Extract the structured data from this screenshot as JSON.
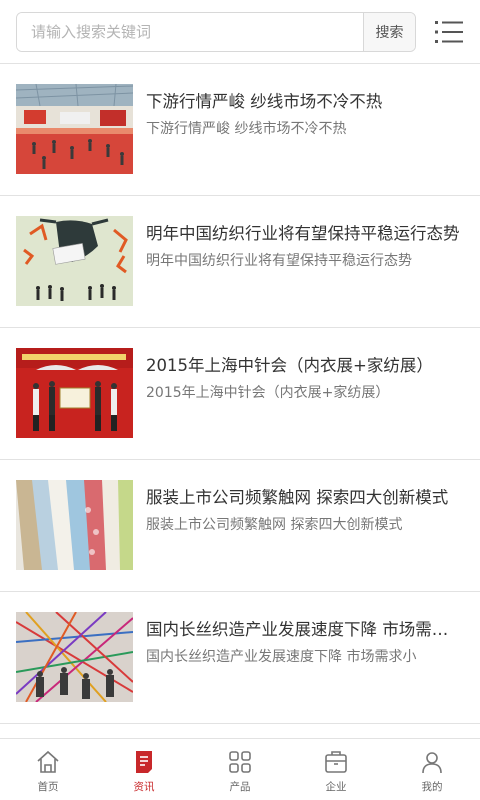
{
  "search": {
    "placeholder": "请输入搜索关键词",
    "button_label": "搜索"
  },
  "news": [
    {
      "title": "下游行情严峻 纱线市场不冷不热",
      "summary": "下游行情严峻 纱线市场不冷不热"
    },
    {
      "title": "明年中国纺织行业将有望保持平稳运行态势",
      "summary": "明年中国纺织行业将有望保持平稳运行态势"
    },
    {
      "title": "2015年上海中针会（内衣展+家纺展）",
      "summary": "2015年上海中针会（内衣展+家纺展）"
    },
    {
      "title": "服装上市公司频繁触网 探索四大创新模式",
      "summary": "服装上市公司频繁触网 探索四大创新模式"
    },
    {
      "title": "国内长丝织造产业发展速度下降 市场需求小",
      "summary": "国内长丝织造产业发展速度下降 市场需求小"
    }
  ],
  "tabbar": [
    {
      "label": "首页",
      "icon": "home-icon"
    },
    {
      "label": "资讯",
      "icon": "news-icon",
      "active": true
    },
    {
      "label": "产品",
      "icon": "grid-icon"
    },
    {
      "label": "企业",
      "icon": "company-icon"
    },
    {
      "label": "我的",
      "icon": "user-icon"
    }
  ],
  "colors": {
    "accent": "#c8282a",
    "divider": "#e2e2e2",
    "text": "#333333",
    "subtext": "#777777"
  }
}
